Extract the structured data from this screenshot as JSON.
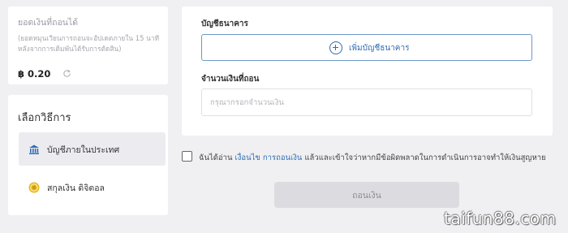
{
  "balance": {
    "title": "ยอดเงินที่ถอนได้",
    "note": "(ยอดหมุนเวียนการถอนจะอัปเดตภายใน 15 นาที หลังจากการเดิมพันได้รับการตัดสิน)",
    "amount": "฿ 0.20"
  },
  "method": {
    "title": "เลือกวิธีการ",
    "items": [
      {
        "label": "บัญชีภายในประเทศ",
        "icon": "bank-icon",
        "selected": true
      },
      {
        "label": "สกุลเงิน ดิจิตอล",
        "icon": "coin-icon",
        "selected": false
      }
    ]
  },
  "form": {
    "bank_label": "บัญชีธนาคาร",
    "add_bank_label": "เพิ่มบัญชีธนาคาร",
    "amount_label": "จำนวนเงินที่ถอน",
    "amount_placeholder": "กรุณากรอกจำนวนเงิน",
    "amount_value": ""
  },
  "agreement": {
    "prefix": "ฉันได้อ่าน",
    "link_terms": "เงื่อนไข",
    "link_withdraw": "การถอนเงิน",
    "suffix": "แล้วและเข้าใจว่าหากมีข้อผิดพลาดในการดำเนินการอาจทำให้เงินสูญหาย",
    "checked": false
  },
  "submit_label": "ถอนเงิน",
  "watermark": "taifun88.com",
  "colors": {
    "accent": "#2f6db5",
    "background": "#f0f0f2",
    "selected_item": "#ececf0",
    "disabled_button": "#dcdce0",
    "coin": "#e8b81e"
  }
}
